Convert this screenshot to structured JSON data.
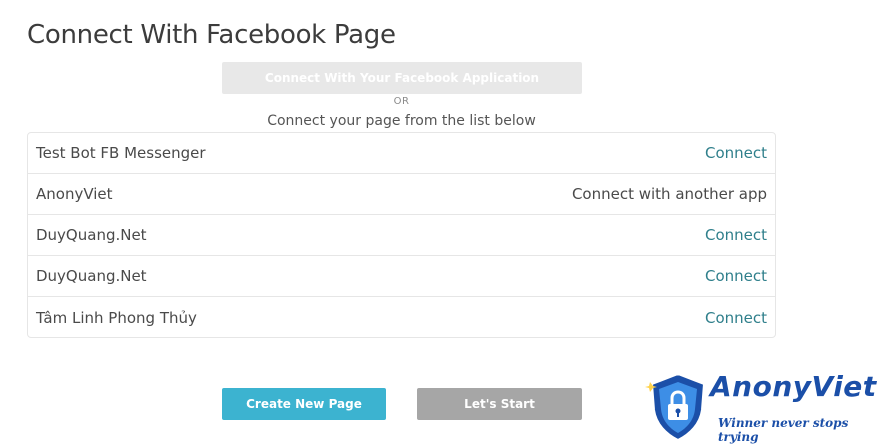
{
  "header": {
    "title": "Connect With Facebook Page"
  },
  "connect_app": {
    "button_label": "Connect With Your Facebook Application",
    "or_label": "OR",
    "list_caption": "Connect your page from the list below"
  },
  "pages": [
    {
      "name": "Test Bot FB Messenger",
      "action": "Connect",
      "actionable": true
    },
    {
      "name": "AnonyViet",
      "action": "Connect with another app",
      "actionable": false
    },
    {
      "name": "DuyQuang.Net",
      "action": "Connect",
      "actionable": true
    },
    {
      "name": "DuyQuang.Net",
      "action": "Connect",
      "actionable": true
    },
    {
      "name": "Tâm Linh Phong Thủy",
      "action": "Connect",
      "actionable": true
    }
  ],
  "footer": {
    "create_label": "Create New Page",
    "start_label": "Let's Start"
  },
  "watermark": {
    "brand": "AnonyViet",
    "slogan": "Winner never stops trying",
    "icon": "shield-lock-icon"
  },
  "colors": {
    "accent_button": "#3cb3d0",
    "disabled_button": "#a6a6a6",
    "link": "#2f7f8b",
    "watermark": "#1b4fa8"
  }
}
